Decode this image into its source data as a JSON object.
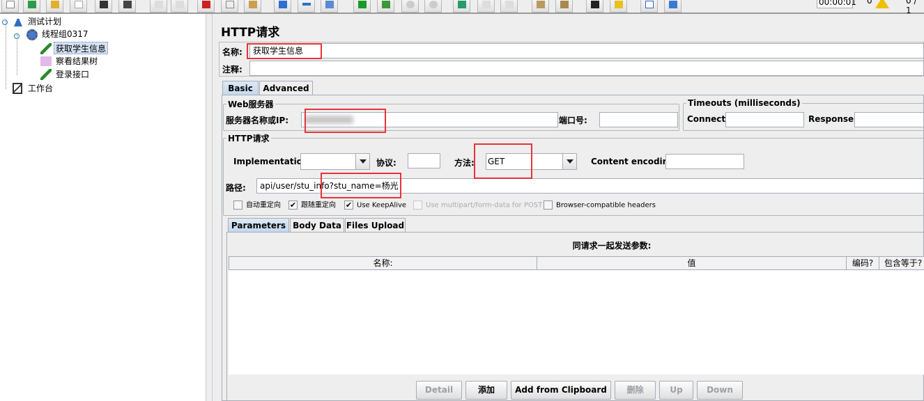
{
  "toolbar": {
    "buttons": [
      "new",
      "templates",
      "open",
      "close",
      "save",
      "save-screenshot",
      "undo",
      "redo",
      "cut",
      "copy",
      "paste",
      "expand",
      "collapse",
      "toggle",
      "start",
      "start-no-pauses",
      "stop",
      "shutdown",
      "remote-start",
      "remote-stop",
      "remote-exit",
      "clear",
      "clear-all",
      "search",
      "reset-search",
      "function-helper",
      "help"
    ],
    "elapsed_time": "00:00:01",
    "warning_count": "0",
    "threads": "0 / 1"
  },
  "tree": {
    "items": [
      {
        "label": "测试计划"
      },
      {
        "label": "线程组0317"
      },
      {
        "label": "获取学生信息"
      },
      {
        "label": "察看结果树"
      },
      {
        "label": "登录接口"
      },
      {
        "label": "工作台"
      }
    ]
  },
  "panel": {
    "title": "HTTP请求",
    "name_label": "名称:",
    "name_value": "获取学生信息",
    "comment_label": "注释:",
    "comment_value": "",
    "tabs": [
      "Basic",
      "Advanced"
    ],
    "web_server": {
      "legend": "Web服务器",
      "server_label": "服务器名称或IP:",
      "port_label": "端口号:",
      "port_value": ""
    },
    "timeouts": {
      "legend": "Timeouts (milliseconds)",
      "connect_label": "Connect:",
      "response_label": "Response:"
    },
    "http_request": {
      "legend": "HTTP请求",
      "implementation_label": "Implementation:",
      "implementation_value": "",
      "protocol_label": "协议:",
      "protocol_value": "",
      "method_label": "方法:",
      "method_value": "GET",
      "encoding_label": "Content encoding:",
      "encoding_value": "",
      "path_label": "路径:",
      "path_value": "api/user/stu_info?stu_name=杨光"
    },
    "checkboxes": [
      {
        "label": "自动重定向",
        "checked": false,
        "enabled": true
      },
      {
        "label": "跟随重定向",
        "checked": true,
        "enabled": true
      },
      {
        "label": "Use KeepAlive",
        "checked": true,
        "enabled": true
      },
      {
        "label": "Use multipart/form-data for POST",
        "checked": false,
        "enabled": false
      },
      {
        "label": "Browser-compatible headers",
        "checked": false,
        "enabled": true
      }
    ],
    "check_mark": "✔",
    "inner_tabs": [
      "Parameters",
      "Body Data",
      "Files Upload"
    ],
    "params_title": "同请求一起发送参数:",
    "columns": [
      "名称:",
      "值",
      "编码?",
      "包含等于?"
    ],
    "buttons": [
      {
        "label": "Detail",
        "enabled": false
      },
      {
        "label": "添加",
        "enabled": true
      },
      {
        "label": "Add from Clipboard",
        "enabled": true
      },
      {
        "label": "删除",
        "enabled": false
      },
      {
        "label": "Up",
        "enabled": false
      },
      {
        "label": "Down",
        "enabled": false
      }
    ]
  },
  "colors": {
    "highlight": "#e8333a",
    "tab_active": "#c3d7ee",
    "selection": "#d4e1f4"
  }
}
